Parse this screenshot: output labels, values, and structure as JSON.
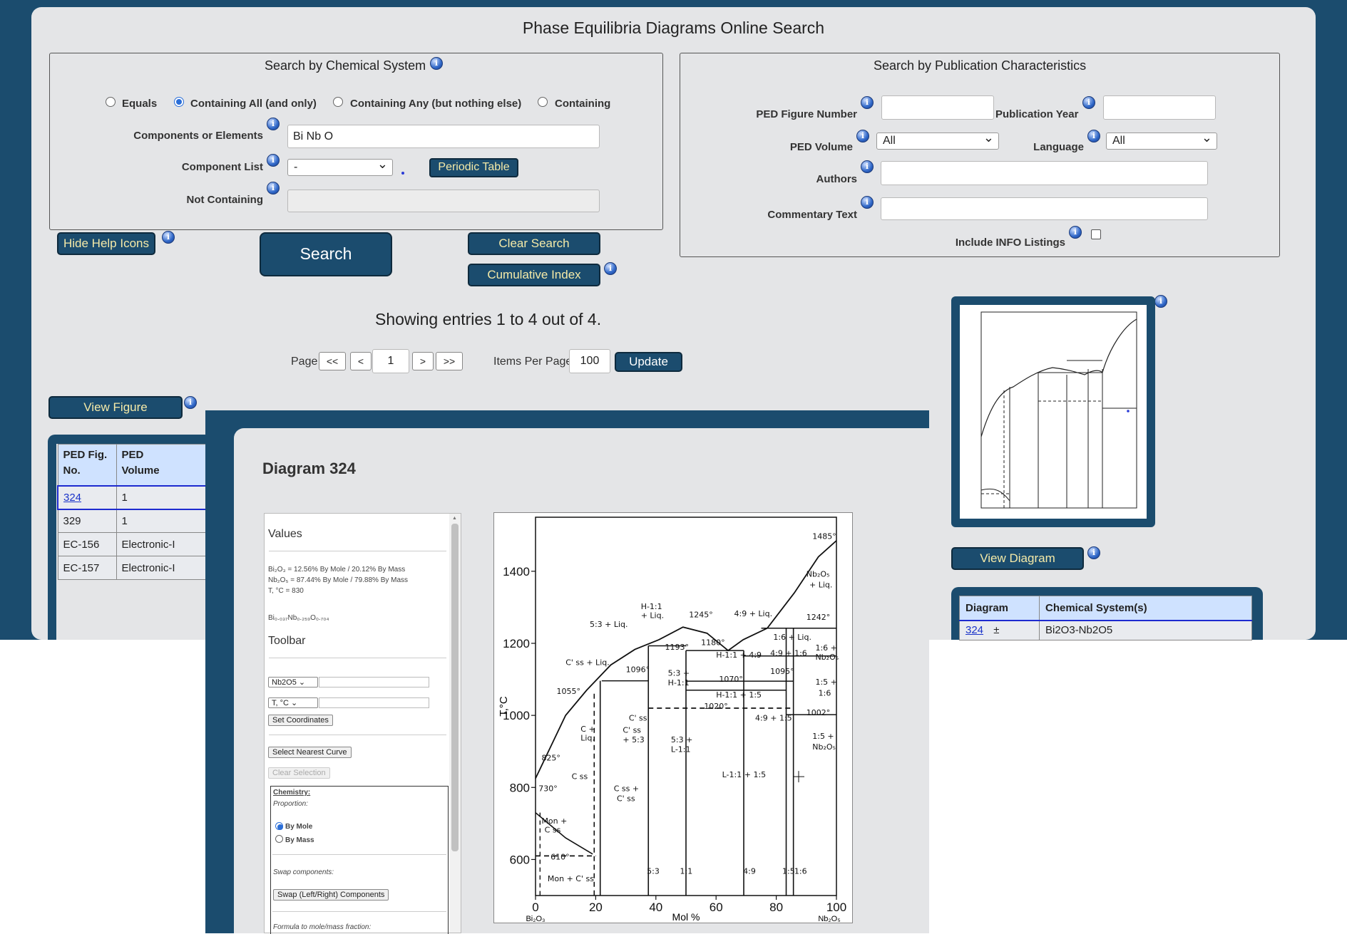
{
  "page_title": "Phase Equilibria Diagrams Online Search",
  "chem_search": {
    "legend": "Search by Chemical System",
    "radio_options": [
      {
        "label": "Equals",
        "checked": false
      },
      {
        "label": "Containing All (and only)",
        "checked": true
      },
      {
        "label": "Containing Any (but nothing else)",
        "checked": false
      },
      {
        "label": "Containing",
        "checked": false
      }
    ],
    "components_label": "Components or Elements",
    "components_value": "Bi Nb O",
    "component_list_label": "Component List",
    "component_list_value": "-",
    "periodic_table_button": "Periodic Table",
    "not_containing_label": "Not Containing",
    "not_containing_value": ""
  },
  "pub_search": {
    "legend": "Search by Publication Characteristics",
    "figure_number_label": "PED Figure Number",
    "figure_number_value": "",
    "pub_year_label": "Publication Year",
    "pub_year_value": "",
    "volume_label": "PED Volume",
    "volume_value": "All",
    "language_label": "Language",
    "language_value": "All",
    "authors_label": "Authors",
    "authors_value": "",
    "commentary_label": "Commentary Text",
    "commentary_value": "",
    "include_info_label": "Include INFO Listings",
    "include_info_checked": false
  },
  "actions": {
    "hide_help": "Hide Help Icons",
    "search": "Search",
    "clear": "Clear Search",
    "cumulative": "Cumulative Index"
  },
  "results": {
    "showing": "Showing entries 1 to 4 out of 4.",
    "page_label": "Page",
    "first": "<<",
    "prev": "<",
    "page_value": "1",
    "next": ">",
    "last": ">>",
    "items_label": "Items Per Page",
    "items_value": "100",
    "update": "Update",
    "view_figure": "View Figure",
    "view_diagram": "View Diagram"
  },
  "left_table": {
    "headers": [
      [
        "PED Fig.",
        "No."
      ],
      [
        "PED",
        "Volume"
      ]
    ],
    "rows": [
      {
        "fig": "324",
        "vol": "1",
        "link": true
      },
      {
        "fig": "329",
        "vol": "1",
        "link": false
      },
      {
        "fig": "EC-156",
        "vol": "Electronic-I",
        "link": false
      },
      {
        "fig": "EC-157",
        "vol": "Electronic-I",
        "link": false
      }
    ]
  },
  "right_table": {
    "headers": [
      "Diagram",
      "Chemical System(s)"
    ],
    "rows": [
      {
        "diagram": "324",
        "system": "Bi2O3-Nb2O5",
        "icon": "±"
      }
    ]
  },
  "popup": {
    "title": "Diagram 324",
    "values_heading": "Values",
    "value_lines": [
      "Bi₂O₃ = 12.56% By Mole / 20.12% By Mass",
      "Nb₂O₅ = 87.44% By Mole / 79.88% By Mass",
      "T, °C = 830"
    ],
    "formula": "Bi₀.₀₃₇Nb₀.₂₅₉O₀.₇₀₄",
    "toolbar_heading": "Toolbar",
    "x_select": "Nb2O5",
    "y_select": "T, °C",
    "set_coords": "Set Coordinates",
    "select_nearest": "Select Nearest Curve",
    "clear_selection": "Clear Selection",
    "chemistry_label": "Chemistry:",
    "proportion_label": "Proportion:",
    "by_mole": "By Mole",
    "by_mass": "By Mass",
    "swap_label": "Swap components:",
    "swap_button": "Swap (Left/Right) Components",
    "formula_label": "Formula to mole/mass fraction:"
  },
  "chart_data": {
    "type": "line",
    "xlabel": "Mol %",
    "ylabel": "T,°C",
    "x_ticks": [
      "0",
      "20",
      "40",
      "60",
      "80",
      "100"
    ],
    "y_ticks": [
      "600",
      "800",
      "1000",
      "1200",
      "1400"
    ],
    "xlim": [
      0,
      100
    ],
    "ylim": [
      500,
      1550
    ],
    "x_left_label": "Bi₂O₃",
    "x_right_label": "Nb₂O₅",
    "annotations": [
      {
        "text": "1485°",
        "x": 92,
        "y": 1490
      },
      {
        "text": "Nb₂O₅",
        "x": 90,
        "y": 1385
      },
      {
        "text": "+ Liq.",
        "x": 91,
        "y": 1355
      },
      {
        "text": "1242°",
        "x": 90,
        "y": 1265
      },
      {
        "text": "H-1:1",
        "x": 35,
        "y": 1295
      },
      {
        "text": "+ Liq.",
        "x": 35,
        "y": 1270
      },
      {
        "text": "1245°",
        "x": 51,
        "y": 1272
      },
      {
        "text": "4:9 + Liq.",
        "x": 66,
        "y": 1275
      },
      {
        "text": "5:3 + Liq.",
        "x": 18,
        "y": 1245
      },
      {
        "text": "1180°",
        "x": 55,
        "y": 1195
      },
      {
        "text": "1193°",
        "x": 43,
        "y": 1182
      },
      {
        "text": "1:6 + Liq.",
        "x": 79,
        "y": 1210
      },
      {
        "text": "1:6 +",
        "x": 93,
        "y": 1180
      },
      {
        "text": "Nb₂O₅",
        "x": 93,
        "y": 1155
      },
      {
        "text": "4:9 + 1:6",
        "x": 78,
        "y": 1165
      },
      {
        "text": "H-1:1 + 4:9",
        "x": 60,
        "y": 1160
      },
      {
        "text": "C' ss + Liq.",
        "x": 10,
        "y": 1140
      },
      {
        "text": "1096°",
        "x": 30,
        "y": 1120
      },
      {
        "text": "1095°",
        "x": 78,
        "y": 1115
      },
      {
        "text": "5:3 +",
        "x": 44,
        "y": 1110
      },
      {
        "text": "H-1:1",
        "x": 44,
        "y": 1083
      },
      {
        "text": "1070°",
        "x": 61,
        "y": 1093
      },
      {
        "text": "1:5 +",
        "x": 93,
        "y": 1085
      },
      {
        "text": "1:6",
        "x": 94,
        "y": 1055
      },
      {
        "text": "1055°",
        "x": 7,
        "y": 1060
      },
      {
        "text": "H-1:1 + 1:5",
        "x": 60,
        "y": 1050
      },
      {
        "text": "1020°",
        "x": 56,
        "y": 1018
      },
      {
        "text": "1002°",
        "x": 90,
        "y": 1000
      },
      {
        "text": "C' ss",
        "x": 31,
        "y": 985
      },
      {
        "text": "4:9 + 1:5",
        "x": 73,
        "y": 985
      },
      {
        "text": "C' ss",
        "x": 29,
        "y": 952
      },
      {
        "text": "+ 5:3",
        "x": 29,
        "y": 925
      },
      {
        "text": "C +",
        "x": 15,
        "y": 955
      },
      {
        "text": "Liq.",
        "x": 15,
        "y": 930
      },
      {
        "text": "5:3 +",
        "x": 45,
        "y": 925
      },
      {
        "text": "L-1:1",
        "x": 45,
        "y": 898
      },
      {
        "text": "1:5 +",
        "x": 92,
        "y": 935
      },
      {
        "text": "Nb₂O₅",
        "x": 92,
        "y": 905
      },
      {
        "text": "825°",
        "x": 2,
        "y": 875
      },
      {
        "text": "C ss",
        "x": 12,
        "y": 823
      },
      {
        "text": "L-1:1 + 1:5",
        "x": 62,
        "y": 828
      },
      {
        "text": "730°",
        "x": 1,
        "y": 790
      },
      {
        "text": "C ss +",
        "x": 26,
        "y": 790
      },
      {
        "text": "C' ss",
        "x": 27,
        "y": 762
      },
      {
        "text": "Mon +",
        "x": 2,
        "y": 700
      },
      {
        "text": "C ss",
        "x": 3,
        "y": 675
      },
      {
        "text": "610°",
        "x": 5,
        "y": 600
      },
      {
        "text": "Mon + C' ss",
        "x": 4,
        "y": 540
      },
      {
        "text": "5:3",
        "x": 37,
        "y": 560
      },
      {
        "text": "1:1",
        "x": 48,
        "y": 560
      },
      {
        "text": "4:9",
        "x": 69,
        "y": 560
      },
      {
        "text": "1:5",
        "x": 82,
        "y": 560
      },
      {
        "text": "1:6",
        "x": 86,
        "y": 560
      }
    ],
    "liquidus": [
      {
        "x": 0,
        "y": 825
      },
      {
        "x": 10,
        "y": 1000
      },
      {
        "x": 17,
        "y": 1070
      },
      {
        "x": 25,
        "y": 1140
      },
      {
        "x": 33,
        "y": 1183
      },
      {
        "x": 41,
        "y": 1210
      },
      {
        "x": 49,
        "y": 1245
      },
      {
        "x": 57,
        "y": 1228
      },
      {
        "x": 64,
        "y": 1180
      },
      {
        "x": 69,
        "y": 1210
      },
      {
        "x": 77,
        "y": 1242
      },
      {
        "x": 86,
        "y": 1340
      },
      {
        "x": 94,
        "y": 1440
      },
      {
        "x": 100,
        "y": 1485
      }
    ],
    "solvus": [
      {
        "x": 0,
        "y": 730
      },
      {
        "x": 10,
        "y": 660
      },
      {
        "x": 19,
        "y": 615
      }
    ],
    "vertical_lines": [
      {
        "x": 37.5,
        "y_top": 1193
      },
      {
        "x": 50,
        "y_top": 1180
      },
      {
        "x": 69.2,
        "y_top": 1180
      },
      {
        "x": 83.3,
        "y_top": 1242
      },
      {
        "x": 85.7,
        "y_top": 1242
      }
    ],
    "horizontal_lines": [
      {
        "y": 1096,
        "x1": 22,
        "x2": 37.5
      },
      {
        "y": 1180,
        "x1": 50,
        "x2": 69.2
      },
      {
        "y": 1095,
        "x1": 50,
        "x2": 85.7
      },
      {
        "y": 1070,
        "x1": 50,
        "x2": 83.3
      },
      {
        "y": 1002,
        "x1": 83.3,
        "x2": 100
      },
      {
        "y": 1242,
        "x1": 75,
        "x2": 100
      },
      {
        "y": 1193,
        "x1": 37.5,
        "x2": 50
      },
      {
        "y": 1165,
        "x1": 69.2,
        "x2": 100
      }
    ],
    "dashed_lines": [
      {
        "y": 1020,
        "x1": 37.5,
        "x2": 85.7
      },
      {
        "y": 610,
        "x1": 0,
        "x2": 20
      }
    ]
  }
}
